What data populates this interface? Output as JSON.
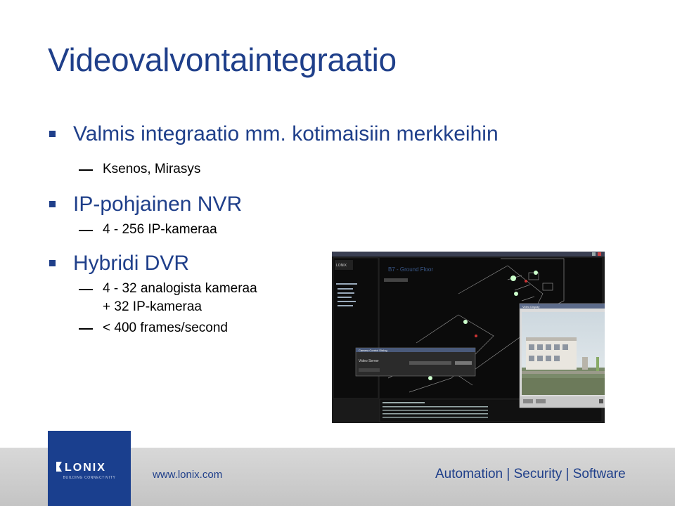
{
  "slide": {
    "title": "Videovalvontaintegraatio",
    "bullets": [
      {
        "text": "Valmis integraatio mm. kotimaisiin merkkeihin",
        "sub": [
          "Ksenos, Mirasys"
        ]
      },
      {
        "text": "IP-pohjainen NVR",
        "sub": [
          "4 - 256 IP-kameraa"
        ]
      },
      {
        "text": "Hybridi DVR",
        "sub": [
          "4 - 32 analogista kameraa",
          "+ 32 IP-kameraa",
          "< 400 frames/second"
        ]
      }
    ]
  },
  "screenshot": {
    "floor_label": "B7 - Ground Floor",
    "dialog_title": "Camera Control Dialog",
    "dialog_label": "Video Server",
    "video_window_title": "Video Display"
  },
  "footer": {
    "brand": "LONIX",
    "brand_tagline": "BUILDING CONNECTIVITY",
    "url": "www.lonix.com",
    "tagline": "Automation | Security | Software"
  },
  "colors": {
    "title_blue": "#1f3f8a",
    "logo_blue": "#1a3f8e",
    "footer_gray": "#c8c8c8"
  }
}
